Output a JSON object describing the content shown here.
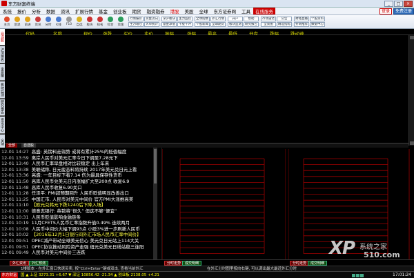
{
  "window": {
    "title": "东方财富终端",
    "min": "_",
    "max": "□",
    "close": "×"
  },
  "menu": [
    "系统",
    "报价",
    "分析",
    "数据",
    "资讯",
    "扩展行情",
    "基金",
    "创业板",
    "期货",
    "融资融券",
    "港股",
    "美股",
    "全球",
    "东方证券网",
    "工具"
  ],
  "menu_highlight": "港股",
  "menu_boxed": "在线服务",
  "menu_right": {
    "login": "登录",
    "register": "免费注册"
  },
  "toolbar": {
    "buttons": [
      {
        "label": "主页",
        "color": "#e04a2a"
      },
      {
        "label": "后退",
        "color": "#e0a21a"
      },
      {
        "label": "前进",
        "color": "#e0a21a"
      },
      {
        "label": "资讯",
        "color": "#c93b3b"
      },
      {
        "label": "分时",
        "color": "#4a7bd0"
      },
      {
        "label": "K线",
        "color": "#4a7bd0"
      },
      {
        "label": "F10",
        "color": "#999999"
      },
      {
        "label": "自选",
        "color": "#d9b221"
      },
      {
        "label": "板块",
        "color": "#cc3333"
      },
      {
        "label": "排名",
        "color": "#cc3333"
      },
      {
        "label": "综合",
        "color": "#2a9e5c"
      },
      {
        "label": "资金",
        "color": "#2a9e5c"
      }
    ],
    "grids": [
      [
        "行情报价",
        "资金流向",
        "主力增仓",
        "大单统计"
      ],
      [
        "深沪板块",
        "主力监控",
        "基金净值",
        "千股千评"
      ],
      [
        "全球指数",
        "外汇行情",
        "个股新闻",
        "全球期货"
      ],
      [
        "开户",
        "帮助",
        "板块监测",
        "研究报告"
      ],
      [
        "市场雷达",
        "公告",
        "全景图",
        "精选指标"
      ],
      [
        "财经直播",
        "个股资料",
        "券商推荐",
        "数据中心"
      ]
    ]
  },
  "side_tabs": [
    "自选股",
    "沪深排名",
    "全景图",
    "板块监测",
    "研究报告",
    "资讯中心",
    "全球"
  ],
  "side_active": 0,
  "table_columns": [
    "代码",
    "名称",
    "现价",
    "涨跌",
    "买价",
    "卖价",
    "振幅",
    "涨幅",
    "最高",
    "最低",
    "开盘",
    "跌幅",
    "跌动速"
  ],
  "tabs": [
    "全部",
    "自选股"
  ],
  "news": [
    {
      "date": "12-01",
      "time": "14:27",
      "text": "高盛: 英镑料走弱势 或将有累计25%的贬值幅度",
      "color": "#ffffff"
    },
    {
      "date": "12-01",
      "time": "13:59",
      "text": "离岸人民币对美元汇率今日下调至7.28元下",
      "color": "#ffffff"
    },
    {
      "date": "12-01",
      "time": "13:40",
      "text": "人民币汇率早盘相对比较稳定 出上年来",
      "color": "#ffffff"
    },
    {
      "date": "12-01",
      "time": "13:38",
      "text": "美联储称, 日元疲态料将持续 2017年美元兑日元上看",
      "color": "#ffffff"
    },
    {
      "date": "12-01",
      "time": "13:36",
      "text": "高盛: 一年目标下看7.14 伤为最具保存性货币",
      "color": "#ffffff"
    },
    {
      "date": "12-01",
      "time": "11:50",
      "text": "高库人民币兑美元日内涨幅扩大至200点 收复6.9",
      "color": "#ffffff"
    },
    {
      "date": "12-01",
      "time": "11:48",
      "text": "高库人民币收复6.90关口",
      "color": "#ffffff"
    },
    {
      "date": "12-01",
      "time": "11:28",
      "text": "任泽平: PMI超预期回升 人民币贬值明显改善出口",
      "color": "#ffffff"
    },
    {
      "date": "12-01",
      "time": "11:25",
      "text": "中国汇市, 人民币对美元中间价 官方PMI大涨推高美",
      "color": "#ffffff"
    },
    {
      "date": "12-01",
      "time": "11:10",
      "text": "【欧元兑韩元下跌1240后下降入场】",
      "color": "#ffff44"
    },
    {
      "date": "12-01",
      "time": "11:00",
      "text": "德意志银行: 英镑将“很久” 但这不够“便宜”",
      "color": "#ffffff"
    },
    {
      "date": "12-01",
      "time": "10:31",
      "text": "人民币贬值影响金融链条",
      "color": "#ffffff"
    },
    {
      "date": "12-01",
      "time": "10:19",
      "text": "11月CFETS人民币汇率指数升值0.49% 连续两月",
      "color": "#ffffff"
    },
    {
      "date": "12-01",
      "time": "10:08",
      "text": "人民币中间价大幅下调93点 小贬3%进一步刷新人民币",
      "color": "#ffffff"
    },
    {
      "date": "12-01",
      "time": "10:02",
      "text": "【2016年12月1日银行间外汇市场人民币汇率中间价】",
      "color": "#ffff44"
    },
    {
      "date": "12-01",
      "time": "09:51",
      "text": "OPEC减产带动全球美元信心 美元兑日元站上114大关",
      "color": "#ffffff"
    },
    {
      "date": "12-01",
      "time": "09:51",
      "text": "OPEC协议推动风险资产走强 纽元兑美元日线站稳三连阳",
      "color": "#ffffff"
    },
    {
      "date": "12-01",
      "time": "09:49",
      "text": "人民币对美元中间价三连跌",
      "color": "#ffffff"
    }
  ],
  "bottom_tabs": [
    "外汇资讯",
    "外汇预测",
    "分时走势",
    "成交明细",
    "分时走势",
    "成交明细"
  ],
  "info_bar": [
    "1楼版本 - 在外汇窗口快速买卖, 按“Ctrl+Enter”键或双击, 查看当前外汇",
    "在外汇分时图里按向右键, 可以调出最大最近外汇分时"
  ],
  "status": {
    "logo": "东方财富",
    "ticker": "国 ▲ 上证 3273.31 +6.67 ▼ 深证 10856.42 -21.34 ▲ 创业板 2138.05 +4.21",
    "time": "17:01:24"
  },
  "watermark": {
    "mark": "XP",
    "cn": "系统之家",
    "site": "510.com"
  }
}
